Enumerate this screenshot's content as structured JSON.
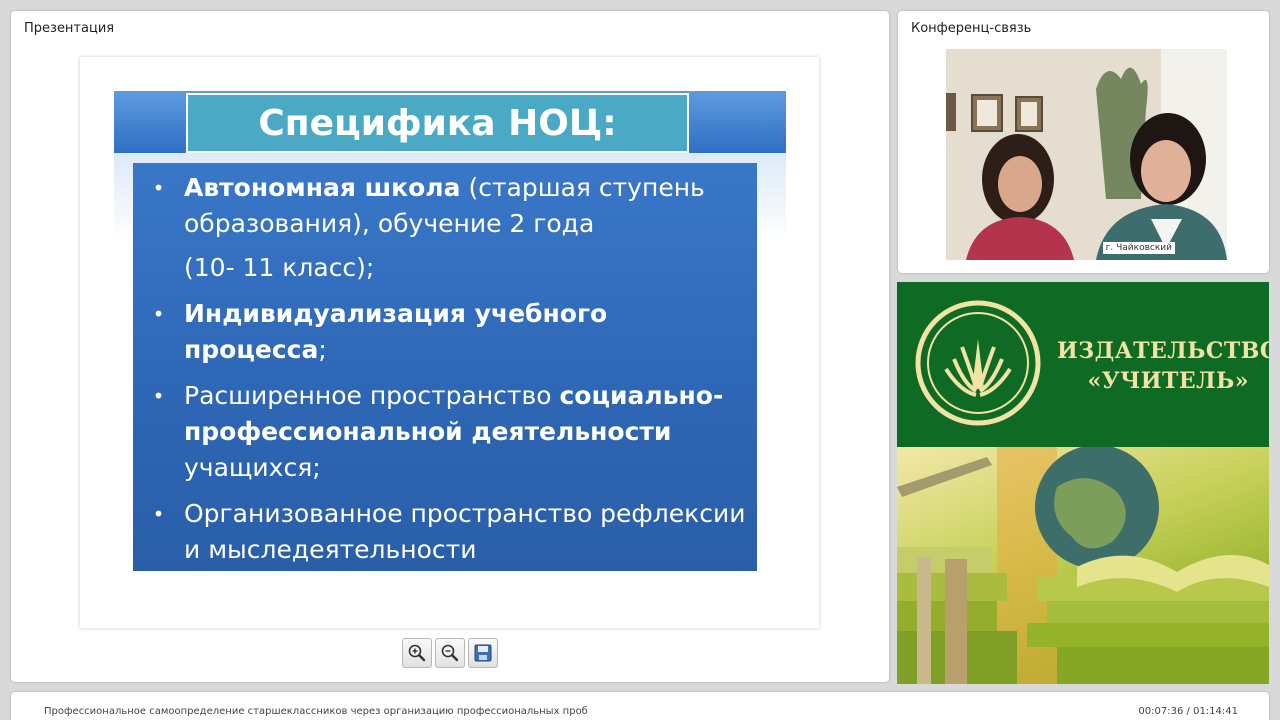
{
  "presentation": {
    "title": "Презентация",
    "slide": {
      "heading": "Специфика НОЦ:",
      "bullets": [
        {
          "bold": "Автономная школа",
          "rest": " (старшая ступень образования), обучение 2 года",
          "line2": "(10- 11 класс);"
        },
        {
          "bold": "Индивидуализация учебного процесса",
          "rest": ";"
        },
        {
          "pre": "Расширенное пространство ",
          "bold": "социально- профессиональной деятельности",
          "rest": " учащихся;"
        },
        {
          "rest": "Организованное пространство рефлексии и мыследеятельности"
        }
      ]
    },
    "tools": [
      {
        "name": "zoom-in",
        "icon": "zoom-in-icon"
      },
      {
        "name": "zoom-out",
        "icon": "zoom-out-icon"
      },
      {
        "name": "save",
        "icon": "save-icon"
      }
    ]
  },
  "conference": {
    "title": "Конференц-связь",
    "video_label": "г. Чайковский"
  },
  "banner": {
    "line1": "ИЗДАТЕЛЬСТВО",
    "line2": "«УЧИТЕЛЬ»"
  },
  "media": {
    "title": "Профессиональное самоопределение старшеклассников через организацию профессиональных проб",
    "current_time": "00:07:36",
    "duration": "01:14:41",
    "separator": " / "
  },
  "colors": {
    "slide_blue": "#2e67b6",
    "title_teal": "#4aa9c4",
    "banner_green": "#0f6b24",
    "banner_gold": "#f1e3a5"
  }
}
